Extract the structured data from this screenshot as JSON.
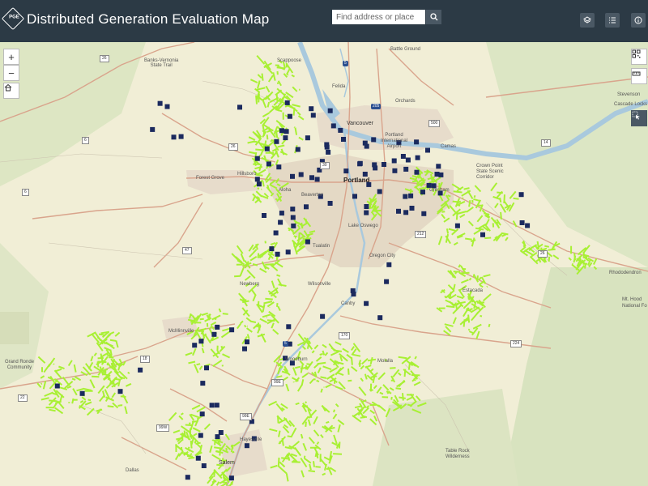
{
  "header": {
    "logo_text": "PGE",
    "title": "Distributed Generation Evaluation Map",
    "search_placeholder": "Find address or place",
    "buttons": [
      "layers-icon",
      "list-icon",
      "info-icon"
    ]
  },
  "map_controls": {
    "zoom_in": "+",
    "zoom_out": "−"
  },
  "place_labels": {
    "battle_ground": "Battle Ground",
    "banks": "Banks-Vernonia\nState Trail",
    "scappoose": "Scappoose",
    "felida": "Felida",
    "orchards": "Orchards",
    "vancouver": "Vancouver",
    "portland_airport": "Portland\nInternational\nAirport",
    "camas": "Camas",
    "crown_point": "Crown Point\nState Scenic\nCorridor",
    "forest_grove": "Forest Grove",
    "hillsboro": "Hillsboro",
    "portland": "Portland",
    "aloha": "Aloha",
    "beaverton": "Beaverton",
    "gresham": "Gresham",
    "tualatin": "Tualatin",
    "oregon_city": "Oregon City",
    "lake_oswego": "Lake Oswego",
    "wilsonville": "Wilsonville",
    "newberg": "Newberg",
    "canby": "Canby",
    "estacada": "Estacada",
    "rhododendron": "Rhododendron",
    "mt_hood": "Mt. Hood\nNational Fo",
    "mcminnville": "McMinnville",
    "grand_ronde": "Grand Ronde\nCommunity",
    "woodburn": "Woodburn",
    "molalla": "Molalla",
    "hayesville": "Hayesville",
    "salem": "Salem",
    "dallas": "Dallas",
    "table_rock": "Table Rock\nWilderness",
    "stevenson": "Stevenson",
    "cascade_locks": "Cascade Locks"
  },
  "road_shields": {
    "r26a": "26",
    "r26b": "26",
    "r26c": "26",
    "i5a": "5",
    "i5b": "5",
    "i205": "205",
    "r500": "500",
    "r14": "14",
    "r6a": "6",
    "r6b": "6",
    "r30": "30",
    "r47": "47",
    "r212": "212",
    "r224": "224",
    "r170": "170",
    "r18": "18",
    "r22": "22",
    "r99e": "99E",
    "r99w": "99W",
    "r99e2": "99E"
  },
  "colors": {
    "header_bg": "#2c3a45",
    "service_area": "#a8f033",
    "marker": "#1b2a5e",
    "urban": "#e3d8c6",
    "water": "#a9c9dd"
  }
}
